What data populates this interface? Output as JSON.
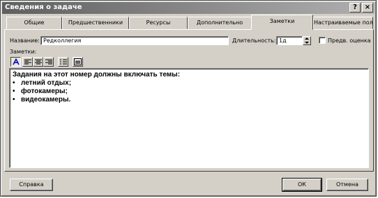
{
  "window": {
    "title": "Сведения о задаче"
  },
  "titlebar_buttons": {
    "help": "?",
    "close": "×"
  },
  "tabs": [
    {
      "label": "Общие"
    },
    {
      "label": "Предшественники"
    },
    {
      "label": "Ресурсы"
    },
    {
      "label": "Дополнительно"
    },
    {
      "label": "Заметки",
      "active": true
    },
    {
      "label": "Настраиваемые поля"
    }
  ],
  "form": {
    "name_label": "Название:",
    "name_value": "Редколлегия",
    "duration_label": "Длительность:",
    "duration_value": "1д",
    "estimate_label": "Предв. оценка",
    "estimate_checked": false,
    "notes_label": "Заметки:"
  },
  "toolbar": {
    "tools": [
      {
        "icon": "font-icon"
      },
      {
        "icon": "align-left-icon"
      },
      {
        "icon": "align-center-icon"
      },
      {
        "icon": "align-right-icon"
      },
      {
        "icon": "bullets-icon"
      },
      {
        "icon": "insert-object-icon"
      }
    ]
  },
  "notes": {
    "heading": "Задания на этот номер должны включать темы:",
    "bullets": [
      "летний отдых;",
      "фотокамеры;",
      "видеокамеры."
    ],
    "bullet_char": "•"
  },
  "buttons": {
    "help": "Справка",
    "ok": "ОК",
    "cancel": "Отмена"
  },
  "colors": {
    "face": "#d4d0c8",
    "titlebar_start": "#5f5f5f",
    "titlebar_end": "#b0b0b0"
  }
}
